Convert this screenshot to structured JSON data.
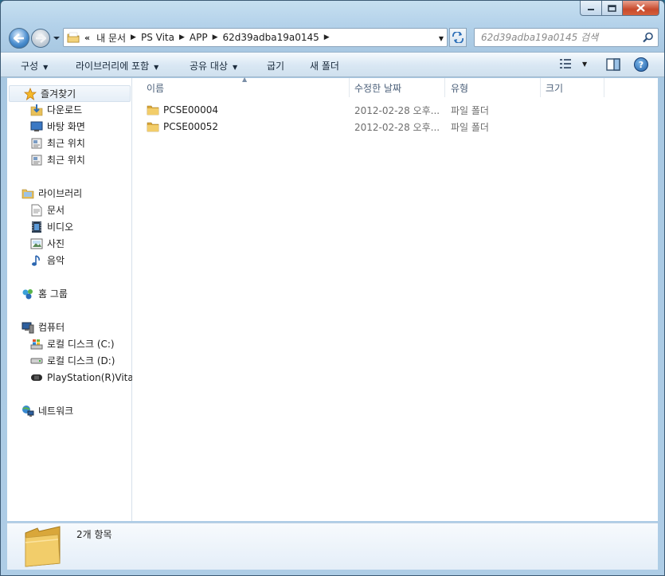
{
  "window": {
    "caption": {
      "minimize_icon": "minimize-icon",
      "maximize_icon": "maximize-icon",
      "close_icon": "close-icon"
    }
  },
  "address": {
    "overflow": "«",
    "segments": [
      {
        "label": "내 문서"
      },
      {
        "label": "PS Vita"
      },
      {
        "label": "APP"
      },
      {
        "label": "62d39adba19a0145"
      }
    ]
  },
  "search": {
    "placeholder": "62d39adba19a0145 검색"
  },
  "toolbar": {
    "organize": "구성",
    "include_in_library": "라이브러리에 포함",
    "share_with": "공유 대상",
    "burn": "굽기",
    "new_folder": "새 폴더",
    "help": "?"
  },
  "sidebar": {
    "favorites": {
      "label": "즐겨찾기",
      "items": [
        {
          "label": "다운로드"
        },
        {
          "label": "바탕 화면"
        },
        {
          "label": "최근 위치"
        },
        {
          "label": "최근 위치"
        }
      ]
    },
    "libraries": {
      "label": "라이브러리",
      "items": [
        {
          "label": "문서"
        },
        {
          "label": "비디오"
        },
        {
          "label": "사진"
        },
        {
          "label": "음악"
        }
      ]
    },
    "homegroup": {
      "label": "홈 그룹"
    },
    "computer": {
      "label": "컴퓨터",
      "items": [
        {
          "label": "로컬 디스크 (C:)"
        },
        {
          "label": "로컬 디스크 (D:)"
        },
        {
          "label": "PlayStation(R)Vita"
        }
      ]
    },
    "network": {
      "label": "네트워크"
    }
  },
  "columns": {
    "name": "이름",
    "date_modified": "수정한 날짜",
    "type": "유형",
    "size": "크기"
  },
  "files": [
    {
      "name": "PCSE00004",
      "date": "2012-02-28 오후...",
      "type": "파일 폴더"
    },
    {
      "name": "PCSE00052",
      "date": "2012-02-28 오후...",
      "type": "파일 폴더"
    }
  ],
  "details": {
    "item_count": "2개 항목"
  },
  "colors": {
    "frame": "#aecde6",
    "accent": "#1f5ea5",
    "folder": "#e8c05a"
  }
}
